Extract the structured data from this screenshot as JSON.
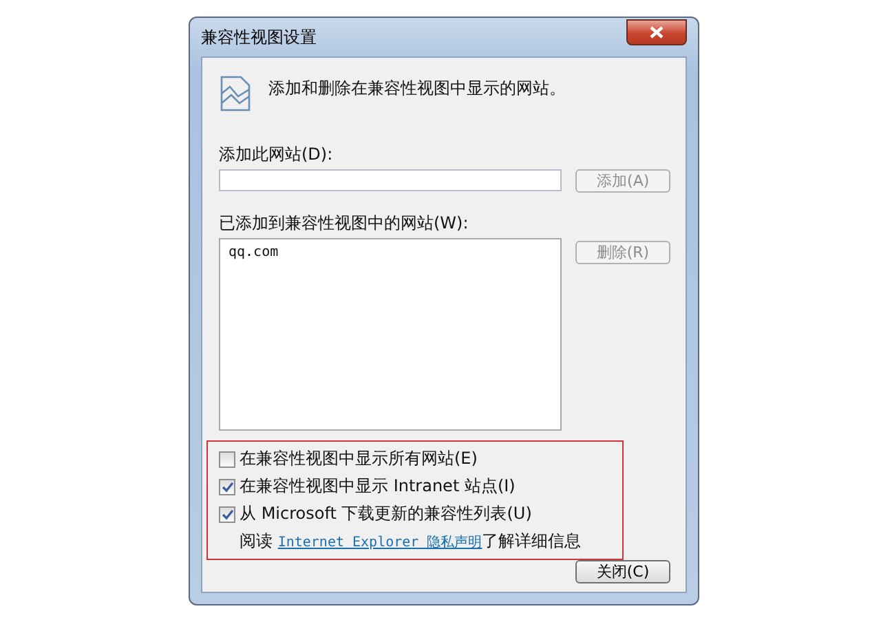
{
  "window": {
    "title": "兼容性视图设置"
  },
  "header": {
    "text": "添加和删除在兼容性视图中显示的网站。"
  },
  "add_site": {
    "label": "添加此网站(D):",
    "button": {
      "label": "添加(A)",
      "disabled": true
    }
  },
  "sites": {
    "label": "已添加到兼容性视图中的网站(W):",
    "items": [
      {
        "text": "qq.com",
        "selected": false
      }
    ],
    "button": {
      "label": "删除(R)",
      "disabled": true
    }
  },
  "options": [
    {
      "label": "在兼容性视图中显示所有网站(E)",
      "checked": false
    },
    {
      "label": "在兼容性视图中显示 Intranet 站点(I)",
      "checked": true
    },
    {
      "label": "从 Microsoft 下载更新的兼容性列表(U)",
      "checked": true
    }
  ],
  "privacy_note": {
    "prefix": "阅读",
    "link": "Internet Explorer 隐私声明",
    "suffix": "了解详细信息"
  },
  "buttons": [
    {
      "label": "关闭(C)",
      "disabled": false
    }
  ]
}
